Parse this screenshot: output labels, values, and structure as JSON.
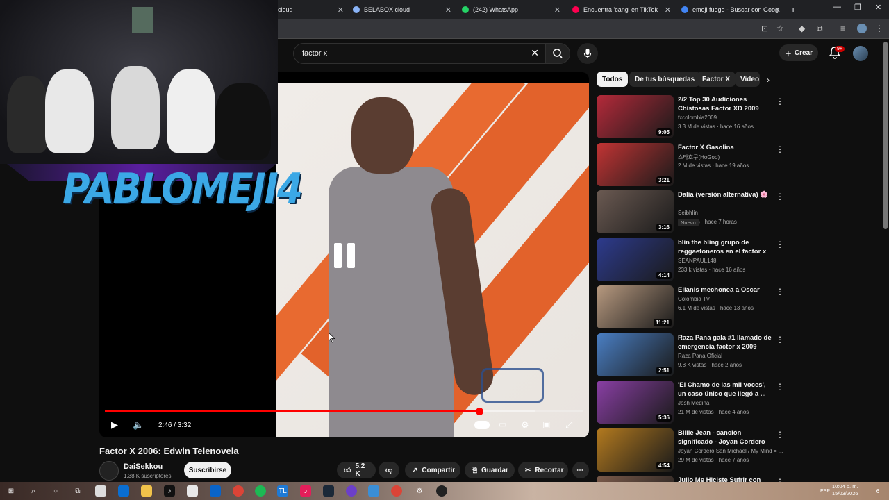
{
  "browser": {
    "tabs": [
      {
        "label": "cloud",
        "icon": "youtube-icon",
        "color": "#3c4043"
      },
      {
        "label": "BELABOX cloud",
        "icon": "globe-icon",
        "color": "#8ab4f8"
      },
      {
        "label": "(242) WhatsApp",
        "icon": "whatsapp-icon",
        "color": "#25d366"
      },
      {
        "label": "Encuentra 'cang' en TikTok",
        "icon": "tiktok-icon",
        "color": "#ff0050"
      },
      {
        "label": "emoji fuego - Buscar con Goog",
        "icon": "google-icon",
        "color": "#4285f4"
      }
    ],
    "new_tab": "+"
  },
  "header": {
    "search_value": "factor x",
    "create_label": "Crear",
    "notif_count": "9+"
  },
  "player": {
    "time": "2:46 / 3:32",
    "progress": 0.783,
    "buffered": 0.9
  },
  "overlay": {
    "streamer_name": "PABLOMEJI4"
  },
  "video": {
    "title": "Factor X 2006: Edwin Telenovela",
    "channel": "DaiSekkou",
    "subscribers": "1.38 K suscriptores",
    "subscribe_label": "Suscribirse",
    "likes": "5.2 K",
    "share_label": "Compartir",
    "save_label": "Guardar",
    "clip_label": "Recortar"
  },
  "chips": [
    "Todos",
    "De tus búsquedas",
    "Factor X",
    "Video"
  ],
  "recommendations": [
    {
      "title": "2/2 Top 30 Audiciones Chistosas Factor XD 2009",
      "channel": "fxcolombia2009",
      "meta": "3.3 M de vistas · hace 16 años",
      "duration": "9:05",
      "thumb": "#b52a3a"
    },
    {
      "title": "Factor X Gasolina",
      "channel": "스타호구(HoGoo)",
      "meta": "2 M de vistas · hace 19 años",
      "duration": "3:21",
      "thumb": "#c23434"
    },
    {
      "title": "Dalia (versión alternativa) 🌸",
      "channel": "Seibhlín",
      "meta": "14 vistas · hace 7 horas",
      "duration": "3:16",
      "badge": "Nuevo",
      "thumb": "#6b5a52"
    },
    {
      "title": "blin the bling grupo de reggaetoneros en el factor x ...",
      "channel": "SEANPAUL148",
      "meta": "233 k vistas · hace 16 años",
      "duration": "4:14",
      "thumb": "#2d3b8e"
    },
    {
      "title": "Elianis mechonea a Oscar",
      "channel": "Colombia TV",
      "meta": "6.1 M de vistas · hace 13 años",
      "duration": "11:21",
      "thumb": "#b89a80"
    },
    {
      "title": "Raza Pana gala #1 llamado de emergencia factor x 2009",
      "channel": "Raza Pana Oficial",
      "meta": "9.8 K vistas · hace 2 años",
      "duration": "2:51",
      "thumb": "#4a7fc4"
    },
    {
      "title": "'El Chamo de las mil voces', un caso único que llegó a ...",
      "channel": "Josh Medina",
      "meta": "21 M de vistas · hace 4 años",
      "duration": "5:36",
      "thumb": "#8a3fa5"
    },
    {
      "title": "Billie Jean - canción significado - Joyan Cordero",
      "channel": "Joyán Cordero San Michael / My Mind = ...",
      "meta": "29 M de vistas · hace 7 años",
      "duration": "4:54",
      "thumb": "#b37a1f"
    },
    {
      "title": "Julio Me Hiciste Sufrir con esta",
      "channel": "",
      "meta": "",
      "duration": "",
      "thumb": "#7a5a4a"
    }
  ],
  "taskbar": {
    "lang": "ESP",
    "time": "10:04 p. m.",
    "date": "15/03/2026",
    "notif": "6"
  }
}
